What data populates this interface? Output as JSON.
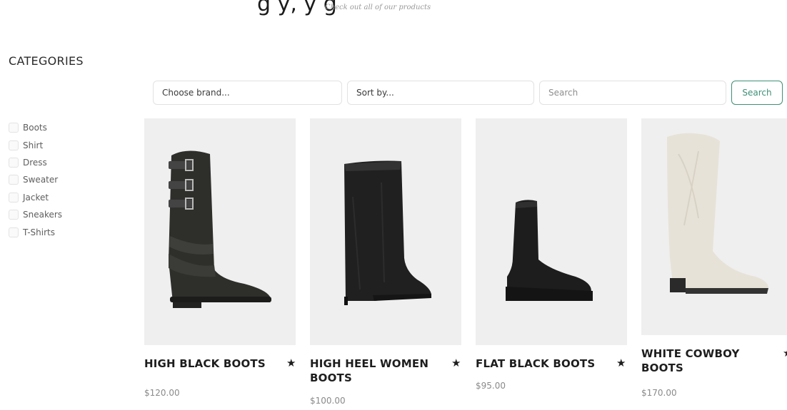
{
  "hero": {
    "title_fragment": "g                              y,                   y        g",
    "subtitle": "Check out all of our products"
  },
  "sidebar": {
    "title": "CATEGORIES",
    "items": [
      {
        "label": "Boots"
      },
      {
        "label": "Shirt"
      },
      {
        "label": "Dress"
      },
      {
        "label": "Sweater"
      },
      {
        "label": "Jacket"
      },
      {
        "label": "Sneakers"
      },
      {
        "label": "T-Shirts"
      }
    ]
  },
  "filters": {
    "brand_placeholder": "Choose brand...",
    "sort_placeholder": "Sort by...",
    "search_placeholder": "Search",
    "search_button": "Search"
  },
  "colors": {
    "accent": "#3f8f77",
    "card_bg": "#efefef"
  },
  "products": [
    {
      "name": "HIGH BLACK BOOTS",
      "price": "$120.00",
      "icon": "star-icon"
    },
    {
      "name": "HIGH HEEL WOMEN BOOTS",
      "price": "$100.00",
      "icon": "star-icon"
    },
    {
      "name": "FLAT BLACK BOOTS",
      "price": "$95.00",
      "icon": "star-icon"
    },
    {
      "name": "WHITE COWBOY BOOTS",
      "price": "$170.00",
      "icon": "star-icon"
    }
  ]
}
